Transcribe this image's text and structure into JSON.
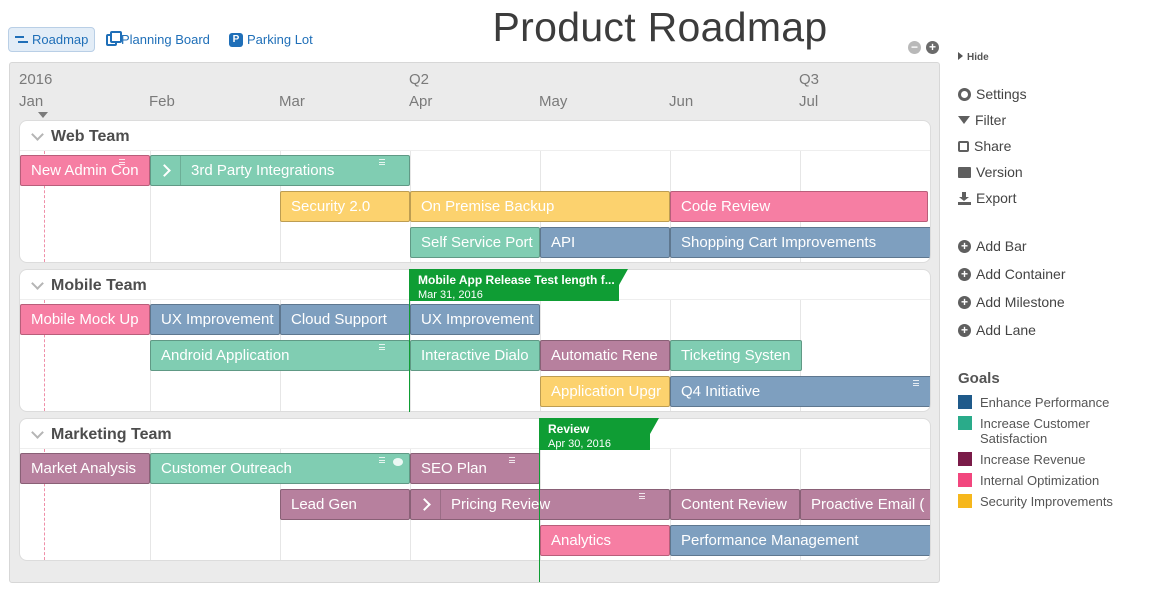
{
  "nav": {
    "tabs": [
      {
        "label": "Roadmap",
        "active": true
      },
      {
        "label": "Planning Board",
        "active": false
      },
      {
        "label": "Parking Lot",
        "active": false
      }
    ]
  },
  "title": "Product Roadmap",
  "zoom": {
    "out": "−",
    "in": "+"
  },
  "timeline": {
    "year": "2016",
    "quarters": [
      "Q2",
      "Q3"
    ],
    "months": [
      "Jan",
      "Feb",
      "Mar",
      "Apr",
      "May",
      "Jun",
      "Jul"
    ]
  },
  "colors": {
    "enhance_performance": "#7e9fbf",
    "increase_customer_satisfaction": "#80cdb2",
    "increase_revenue": "#b7809e",
    "internal_optimization": "#f67ea3",
    "security_improvements": "#fcd26e",
    "milestone": "#0f9d34"
  },
  "containers": [
    {
      "name": "Web Team",
      "bars": [
        {
          "label": "New Admin Con",
          "goal": "internal_optimization"
        },
        {
          "label": "3rd Party Integrations",
          "goal": "increase_customer_satisfaction"
        },
        {
          "label": "Security 2.0",
          "goal": "security_improvements"
        },
        {
          "label": "On Premise Backup",
          "goal": "security_improvements"
        },
        {
          "label": "Code Review",
          "goal": "internal_optimization"
        },
        {
          "label": "Self Service Port",
          "goal": "increase_customer_satisfaction"
        },
        {
          "label": "API",
          "goal": "enhance_performance"
        },
        {
          "label": "Shopping Cart Improvements",
          "goal": "enhance_performance"
        }
      ]
    },
    {
      "name": "Mobile Team",
      "bars": [
        {
          "label": "Mobile Mock Up",
          "goal": "internal_optimization"
        },
        {
          "label": "UX Improvement",
          "goal": "enhance_performance"
        },
        {
          "label": "Cloud Support",
          "goal": "enhance_performance"
        },
        {
          "label": "UX Improvement",
          "goal": "enhance_performance"
        },
        {
          "label": "Android Application",
          "goal": "increase_customer_satisfaction"
        },
        {
          "label": "Interactive Dialo",
          "goal": "increase_customer_satisfaction"
        },
        {
          "label": "Automatic Rene",
          "goal": "increase_revenue"
        },
        {
          "label": "Ticketing Systen",
          "goal": "increase_customer_satisfaction"
        },
        {
          "label": "Application Upgr",
          "goal": "security_improvements"
        },
        {
          "label": "Q4 Initiative",
          "goal": "enhance_performance"
        }
      ]
    },
    {
      "name": "Marketing Team",
      "bars": [
        {
          "label": "Market Analysis",
          "goal": "increase_revenue"
        },
        {
          "label": "Customer Outreach",
          "goal": "increase_customer_satisfaction"
        },
        {
          "label": "SEO Plan",
          "goal": "increase_revenue"
        },
        {
          "label": "Lead Gen",
          "goal": "increase_revenue"
        },
        {
          "label": "Pricing Review",
          "goal": "increase_revenue"
        },
        {
          "label": "Content Review",
          "goal": "increase_revenue"
        },
        {
          "label": "Proactive Email (",
          "goal": "increase_revenue"
        },
        {
          "label": "Analytics",
          "goal": "internal_optimization"
        },
        {
          "label": "Performance Management",
          "goal": "enhance_performance"
        }
      ]
    }
  ],
  "milestones": [
    {
      "name": "Mobile App Release Test length f...",
      "date": "Mar 31, 2016"
    },
    {
      "name": "Review",
      "date": "Apr 30, 2016"
    }
  ],
  "right_panel": {
    "hide": "Hide",
    "actions": [
      "Settings",
      "Filter",
      "Share",
      "Version",
      "Export"
    ],
    "adds": [
      "Add Bar",
      "Add Container",
      "Add Milestone",
      "Add Lane"
    ],
    "goals_title": "Goals",
    "goals": [
      {
        "label": "Enhance Performance",
        "color": "#1f5a8a"
      },
      {
        "label": "Increase Customer Satisfaction",
        "color": "#2aab8a"
      },
      {
        "label": "Increase Revenue",
        "color": "#7a1b48"
      },
      {
        "label": "Internal Optimization",
        "color": "#f2467e"
      },
      {
        "label": "Security Improvements",
        "color": "#f6b71c"
      }
    ]
  }
}
